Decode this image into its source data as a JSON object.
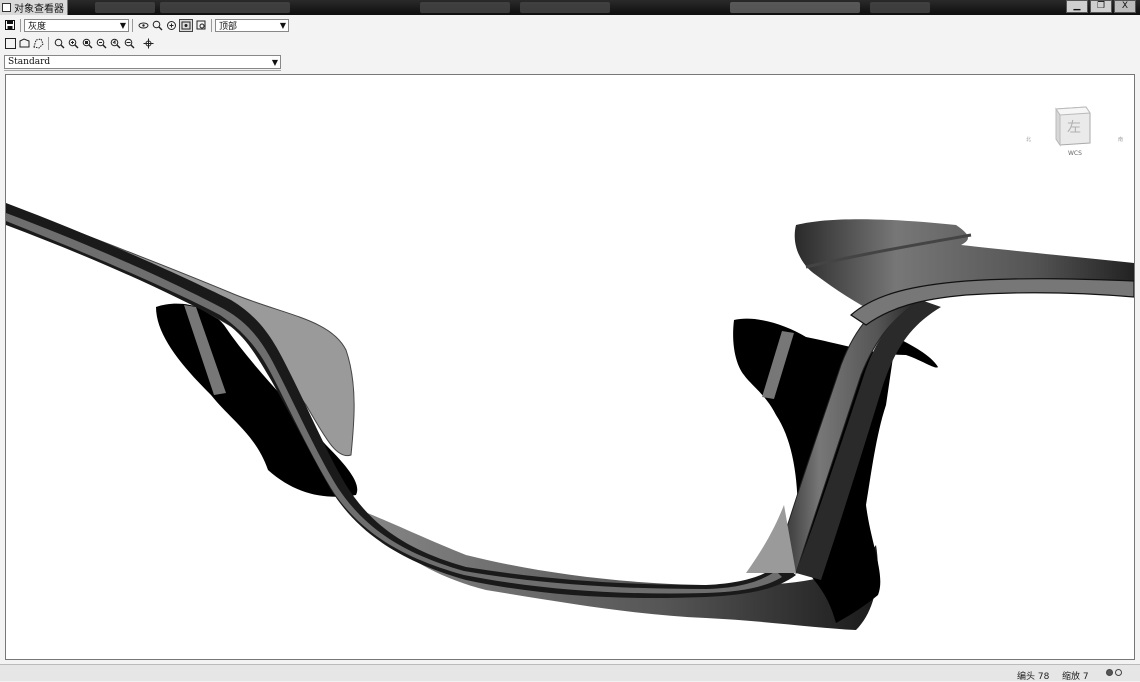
{
  "window": {
    "title": "对象查看器",
    "controls": {
      "minimize": "▁",
      "maximize": "❐",
      "close": "X"
    }
  },
  "toolbar": {
    "visual_style": "灰度",
    "view_dropdown": "顶部",
    "named_view": "Standard"
  },
  "viewcube": {
    "face_label": "左",
    "compass_left": "北",
    "compass_right": "南",
    "compass_bottom": "WCS"
  },
  "status": {
    "left_text": "编头 78",
    "right_text": "缩放 7"
  },
  "colors": {
    "window_bg": "#f3f3f3",
    "viewport_bg": "#ffffff",
    "surface_dark": "#000000",
    "surface_mid": "#555555",
    "surface_light": "#9a9a9a"
  }
}
